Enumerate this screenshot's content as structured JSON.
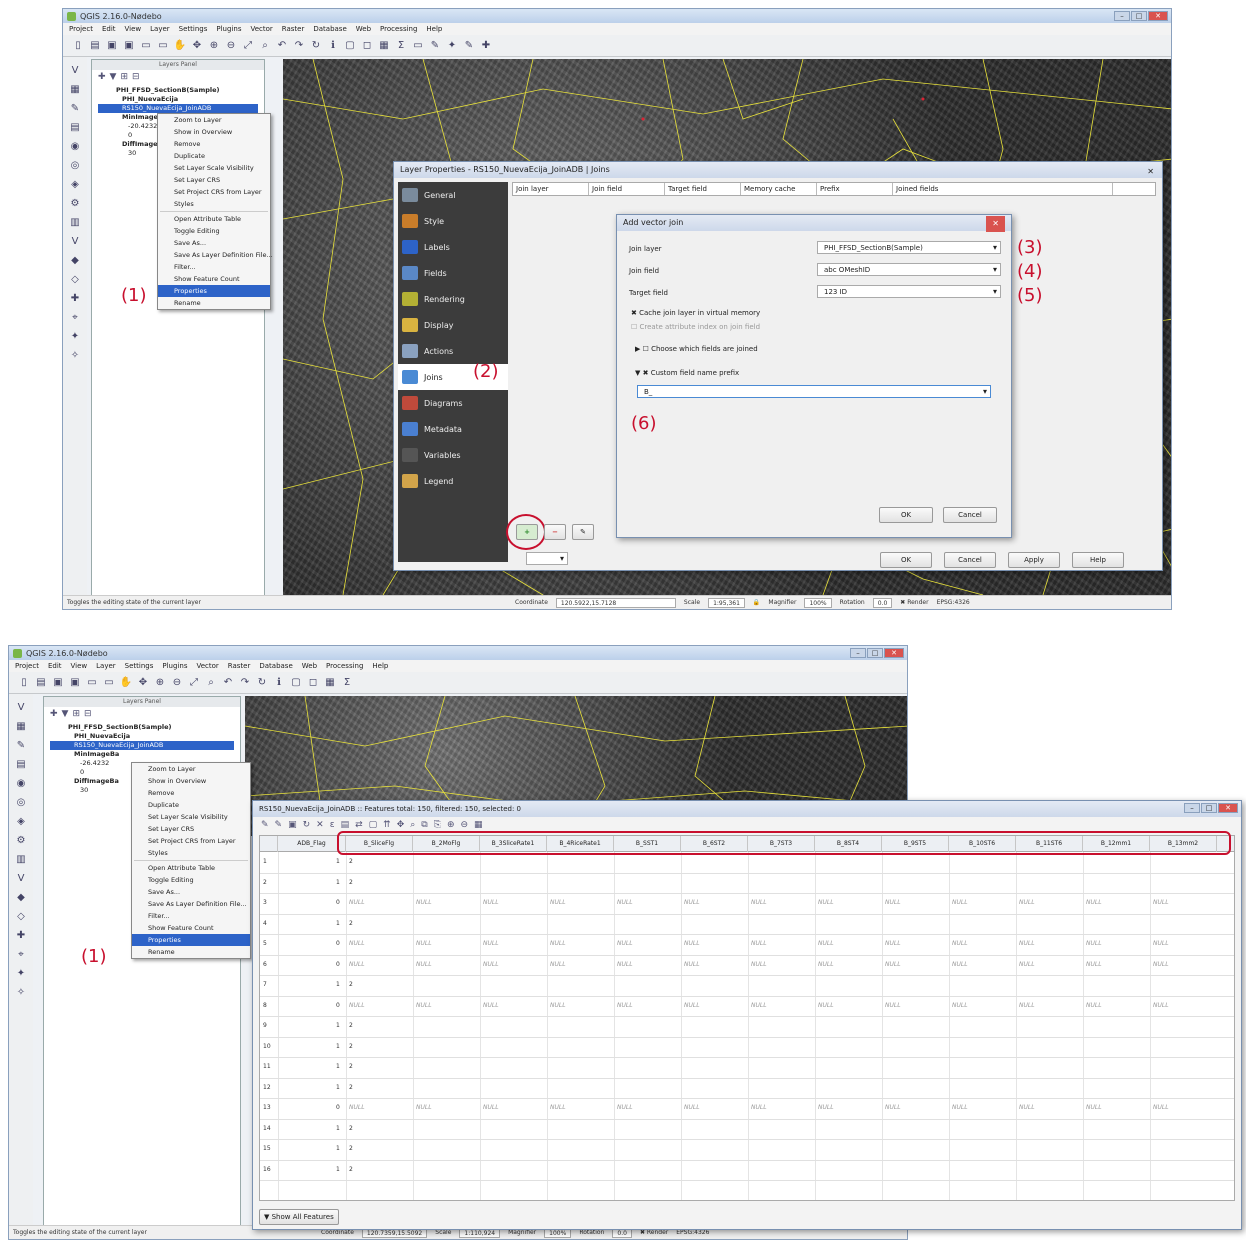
{
  "s1": {
    "title": "QGIS 2.16.0-Nødebo",
    "menus": [
      "Project",
      "Edit",
      "View",
      "Layer",
      "Settings",
      "Plugins",
      "Vector",
      "Raster",
      "Database",
      "Web",
      "Processing",
      "Help"
    ],
    "layers_panel_title": "Layers Panel",
    "tree": [
      "PHI_FFSD_SectionB(Sample)",
      "PHI_NuevaEcija",
      "RS150_NuevaEcija_JoinADB",
      "MinImage",
      "-20.4232",
      "0",
      "DiffImage",
      "30"
    ],
    "ctx": [
      "Zoom to Layer",
      "Show in Overview",
      "Remove",
      "Duplicate",
      "Set Layer Scale Visibility",
      "Set Layer CRS",
      "Set Project CRS from Layer",
      "Styles",
      "Open Attribute Table",
      "Toggle Editing",
      "Save As...",
      "Save As Layer Definition File...",
      "Filter...",
      "Show Feature Count",
      "Properties",
      "Rename"
    ],
    "props_title": "Layer Properties - RS150_NuevaEcija_JoinADB | Joins",
    "sidebar": [
      "General",
      "Style",
      "Labels",
      "Fields",
      "Rendering",
      "Display",
      "Actions",
      "Joins",
      "Diagrams",
      "Metadata",
      "Variables",
      "Legend"
    ],
    "join_cols": [
      "Join layer",
      "Join field",
      "Target field",
      "Memory cache",
      "Prefix",
      "Joined fields"
    ],
    "addjoin_title": "Add vector join",
    "f_join_layer": "Join layer",
    "v_join_layer": "PHI_FFSD_SectionB(Sample)",
    "f_join_field": "Join field",
    "v_join_field": "abc OMeshID",
    "f_target_field": "Target field",
    "v_target_field": "123 ID",
    "cache": "Cache join layer in virtual memory",
    "index": "Create attribute index on join field",
    "choose": "Choose which fields are joined",
    "prefix_label": "Custom field name prefix",
    "prefix_value": "B_",
    "ok": "OK",
    "cancel": "Cancel",
    "apply": "Apply",
    "help": "Help",
    "style": "Style",
    "status_left": "Toggles the editing state of the current layer",
    "coord_label": "Coordinate",
    "coord": "120.5922,15.7128",
    "scale_label": "Scale",
    "scale": "1:95,361",
    "magnifier_label": "Magnifier",
    "magnifier": "100%",
    "rotation_label": "Rotation",
    "rotation": "0.0",
    "render": "Render",
    "crs": "EPSG:4326",
    "a1": "(1)",
    "a2": "(2)",
    "a3": "(3)",
    "a4": "(4)",
    "a5": "(5)",
    "a6": "(6)"
  },
  "s2": {
    "title": "QGIS 2.16.0-Nødebo",
    "menus": [
      "Project",
      "Edit",
      "View",
      "Layer",
      "Settings",
      "Plugins",
      "Vector",
      "Raster",
      "Database",
      "Web",
      "Processing",
      "Help"
    ],
    "layers_panel_title": "Layers Panel",
    "tree": [
      "PHI_FFSD_SectionB(Sample)",
      "PHI_NuevaEcija",
      "RS150_NuevaEcija_JoinADB",
      "MinImageBa",
      "-26.4232",
      "0",
      "DiffImageBa",
      "30"
    ],
    "ctx": [
      "Zoom to Layer",
      "Show in Overview",
      "Remove",
      "Duplicate",
      "Set Layer Scale Visibility",
      "Set Layer CRS",
      "Set Project CRS from Layer",
      "Styles",
      "Open Attribute Table",
      "Toggle Editing",
      "Save As...",
      "Save As Layer Definition File...",
      "Filter...",
      "Show Feature Count",
      "Properties",
      "Rename"
    ],
    "attr_title": "RS150_NuevaEcija_JoinADB :: Features total: 150, filtered: 150, selected: 0",
    "columns": [
      "ADB_Flag",
      "B_SliceFlg",
      "B_2MoFlg",
      "B_3SliceRate1",
      "B_4RiceRate1",
      "B_SST1",
      "B_6ST2",
      "B_7ST3",
      "B_8ST4",
      "B_9ST5",
      "B_10ST6",
      "B_11ST6",
      "B_12mm1",
      "B_13mm2"
    ],
    "rows": [
      "1|2",
      "1|2",
      "0|NULL",
      "1|2",
      "0|NULL",
      "0|NULL",
      "1|2",
      "0|NULL",
      "1|2",
      "1|2",
      "1|2",
      "1|2",
      "0|NULL",
      "1|2",
      "1|2",
      "1|2"
    ],
    "show_all": "Show All Features",
    "status_left": "Toggles the editing state of the current layer",
    "coord_label": "Coordinate",
    "coord": "120.7359,15.5092",
    "scale_label": "Scale",
    "scale": "1:110,924",
    "magnifier_label": "Magnifier",
    "magnifier": "100%",
    "rotation_label": "Rotation",
    "rotation": "0.0",
    "render": "Render",
    "crs": "EPSG:4326",
    "a1": "(1)"
  }
}
